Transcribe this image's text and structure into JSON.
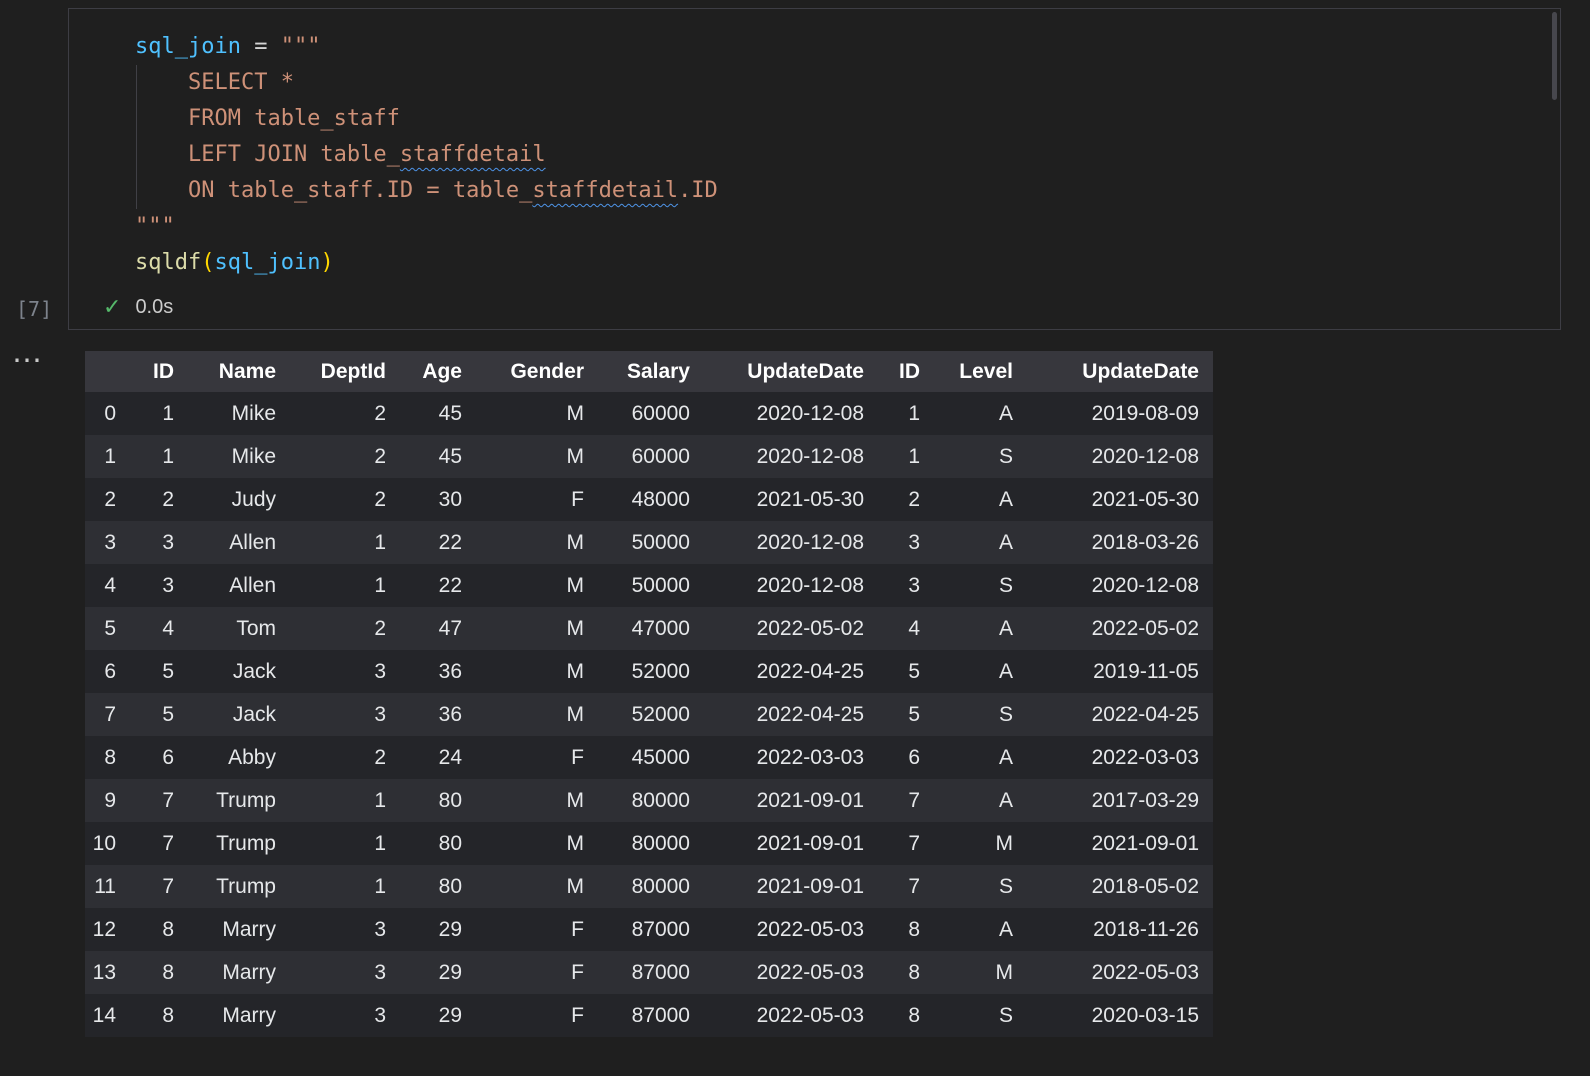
{
  "cell": {
    "execution_count": "[7]",
    "status": {
      "check_icon": "✓",
      "time": "0.0s"
    },
    "more_actions": "⋯",
    "code_lines": [
      [
        {
          "t": "sql_join",
          "c": "var"
        },
        {
          "t": " = ",
          "c": "op"
        },
        {
          "t": "\"\"\"",
          "c": "str"
        }
      ],
      [
        {
          "t": "    SELECT *",
          "c": "str"
        }
      ],
      [
        {
          "t": "    FROM table_staff",
          "c": "str"
        }
      ],
      [
        {
          "t": "    LEFT JOIN table_",
          "c": "str"
        },
        {
          "t": "staffdetail",
          "c": "str",
          "sq": true
        }
      ],
      [
        {
          "t": "    ON table_staff.ID = table_",
          "c": "str"
        },
        {
          "t": "staffdetail",
          "c": "str",
          "sq": true
        },
        {
          "t": ".ID",
          "c": "str"
        }
      ],
      [
        {
          "t": "\"\"\"",
          "c": "str"
        }
      ],
      [
        {
          "t": "sqldf",
          "c": "fn"
        },
        {
          "t": "(",
          "c": "br"
        },
        {
          "t": "sql_join",
          "c": "var"
        },
        {
          "t": ")",
          "c": "br"
        }
      ]
    ]
  },
  "table": {
    "columns": [
      "",
      "ID",
      "Name",
      "DeptId",
      "Age",
      "Gender",
      "Salary",
      "UpdateDate",
      "ID",
      "Level",
      "UpdateDate"
    ],
    "rows": [
      [
        "0",
        "1",
        "Mike",
        "2",
        "45",
        "M",
        "60000",
        "2020-12-08",
        "1",
        "A",
        "2019-08-09"
      ],
      [
        "1",
        "1",
        "Mike",
        "2",
        "45",
        "M",
        "60000",
        "2020-12-08",
        "1",
        "S",
        "2020-12-08"
      ],
      [
        "2",
        "2",
        "Judy",
        "2",
        "30",
        "F",
        "48000",
        "2021-05-30",
        "2",
        "A",
        "2021-05-30"
      ],
      [
        "3",
        "3",
        "Allen",
        "1",
        "22",
        "M",
        "50000",
        "2020-12-08",
        "3",
        "A",
        "2018-03-26"
      ],
      [
        "4",
        "3",
        "Allen",
        "1",
        "22",
        "M",
        "50000",
        "2020-12-08",
        "3",
        "S",
        "2020-12-08"
      ],
      [
        "5",
        "4",
        "Tom",
        "2",
        "47",
        "M",
        "47000",
        "2022-05-02",
        "4",
        "A",
        "2022-05-02"
      ],
      [
        "6",
        "5",
        "Jack",
        "3",
        "36",
        "M",
        "52000",
        "2022-04-25",
        "5",
        "A",
        "2019-11-05"
      ],
      [
        "7",
        "5",
        "Jack",
        "3",
        "36",
        "M",
        "52000",
        "2022-04-25",
        "5",
        "S",
        "2022-04-25"
      ],
      [
        "8",
        "6",
        "Abby",
        "2",
        "24",
        "F",
        "45000",
        "2022-03-03",
        "6",
        "A",
        "2022-03-03"
      ],
      [
        "9",
        "7",
        "Trump",
        "1",
        "80",
        "M",
        "80000",
        "2021-09-01",
        "7",
        "A",
        "2017-03-29"
      ],
      [
        "10",
        "7",
        "Trump",
        "1",
        "80",
        "M",
        "80000",
        "2021-09-01",
        "7",
        "M",
        "2021-09-01"
      ],
      [
        "11",
        "7",
        "Trump",
        "1",
        "80",
        "M",
        "80000",
        "2021-09-01",
        "7",
        "S",
        "2018-05-02"
      ],
      [
        "12",
        "8",
        "Marry",
        "3",
        "29",
        "F",
        "87000",
        "2022-05-03",
        "8",
        "A",
        "2018-11-26"
      ],
      [
        "13",
        "8",
        "Marry",
        "3",
        "29",
        "F",
        "87000",
        "2022-05-03",
        "8",
        "M",
        "2022-05-03"
      ],
      [
        "14",
        "8",
        "Marry",
        "3",
        "29",
        "F",
        "87000",
        "2022-05-03",
        "8",
        "S",
        "2020-03-15"
      ]
    ]
  }
}
